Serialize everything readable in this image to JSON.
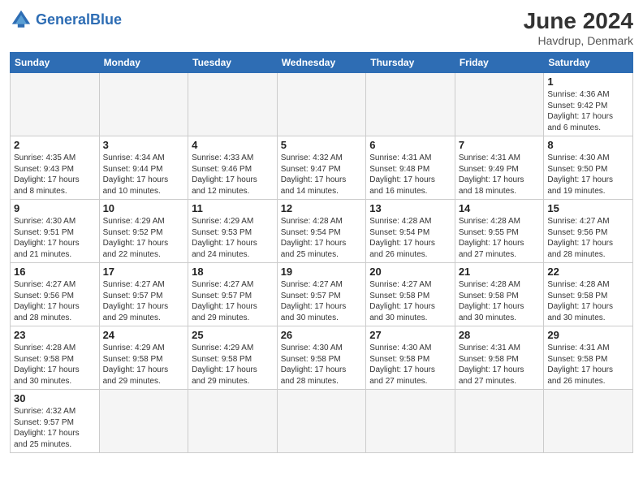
{
  "header": {
    "logo_general": "General",
    "logo_blue": "Blue",
    "month_title": "June 2024",
    "location": "Havdrup, Denmark"
  },
  "days_of_week": [
    "Sunday",
    "Monday",
    "Tuesday",
    "Wednesday",
    "Thursday",
    "Friday",
    "Saturday"
  ],
  "weeks": [
    [
      {
        "day": "",
        "info": ""
      },
      {
        "day": "",
        "info": ""
      },
      {
        "day": "",
        "info": ""
      },
      {
        "day": "",
        "info": ""
      },
      {
        "day": "",
        "info": ""
      },
      {
        "day": "",
        "info": ""
      },
      {
        "day": "1",
        "info": "Sunrise: 4:36 AM\nSunset: 9:42 PM\nDaylight: 17 hours\nand 6 minutes."
      }
    ],
    [
      {
        "day": "2",
        "info": "Sunrise: 4:35 AM\nSunset: 9:43 PM\nDaylight: 17 hours\nand 8 minutes."
      },
      {
        "day": "3",
        "info": "Sunrise: 4:34 AM\nSunset: 9:44 PM\nDaylight: 17 hours\nand 10 minutes."
      },
      {
        "day": "4",
        "info": "Sunrise: 4:33 AM\nSunset: 9:46 PM\nDaylight: 17 hours\nand 12 minutes."
      },
      {
        "day": "5",
        "info": "Sunrise: 4:32 AM\nSunset: 9:47 PM\nDaylight: 17 hours\nand 14 minutes."
      },
      {
        "day": "6",
        "info": "Sunrise: 4:31 AM\nSunset: 9:48 PM\nDaylight: 17 hours\nand 16 minutes."
      },
      {
        "day": "7",
        "info": "Sunrise: 4:31 AM\nSunset: 9:49 PM\nDaylight: 17 hours\nand 18 minutes."
      },
      {
        "day": "8",
        "info": "Sunrise: 4:30 AM\nSunset: 9:50 PM\nDaylight: 17 hours\nand 19 minutes."
      }
    ],
    [
      {
        "day": "9",
        "info": "Sunrise: 4:30 AM\nSunset: 9:51 PM\nDaylight: 17 hours\nand 21 minutes."
      },
      {
        "day": "10",
        "info": "Sunrise: 4:29 AM\nSunset: 9:52 PM\nDaylight: 17 hours\nand 22 minutes."
      },
      {
        "day": "11",
        "info": "Sunrise: 4:29 AM\nSunset: 9:53 PM\nDaylight: 17 hours\nand 24 minutes."
      },
      {
        "day": "12",
        "info": "Sunrise: 4:28 AM\nSunset: 9:54 PM\nDaylight: 17 hours\nand 25 minutes."
      },
      {
        "day": "13",
        "info": "Sunrise: 4:28 AM\nSunset: 9:54 PM\nDaylight: 17 hours\nand 26 minutes."
      },
      {
        "day": "14",
        "info": "Sunrise: 4:28 AM\nSunset: 9:55 PM\nDaylight: 17 hours\nand 27 minutes."
      },
      {
        "day": "15",
        "info": "Sunrise: 4:27 AM\nSunset: 9:56 PM\nDaylight: 17 hours\nand 28 minutes."
      }
    ],
    [
      {
        "day": "16",
        "info": "Sunrise: 4:27 AM\nSunset: 9:56 PM\nDaylight: 17 hours\nand 28 minutes."
      },
      {
        "day": "17",
        "info": "Sunrise: 4:27 AM\nSunset: 9:57 PM\nDaylight: 17 hours\nand 29 minutes."
      },
      {
        "day": "18",
        "info": "Sunrise: 4:27 AM\nSunset: 9:57 PM\nDaylight: 17 hours\nand 29 minutes."
      },
      {
        "day": "19",
        "info": "Sunrise: 4:27 AM\nSunset: 9:57 PM\nDaylight: 17 hours\nand 30 minutes."
      },
      {
        "day": "20",
        "info": "Sunrise: 4:27 AM\nSunset: 9:58 PM\nDaylight: 17 hours\nand 30 minutes."
      },
      {
        "day": "21",
        "info": "Sunrise: 4:28 AM\nSunset: 9:58 PM\nDaylight: 17 hours\nand 30 minutes."
      },
      {
        "day": "22",
        "info": "Sunrise: 4:28 AM\nSunset: 9:58 PM\nDaylight: 17 hours\nand 30 minutes."
      }
    ],
    [
      {
        "day": "23",
        "info": "Sunrise: 4:28 AM\nSunset: 9:58 PM\nDaylight: 17 hours\nand 30 minutes."
      },
      {
        "day": "24",
        "info": "Sunrise: 4:29 AM\nSunset: 9:58 PM\nDaylight: 17 hours\nand 29 minutes."
      },
      {
        "day": "25",
        "info": "Sunrise: 4:29 AM\nSunset: 9:58 PM\nDaylight: 17 hours\nand 29 minutes."
      },
      {
        "day": "26",
        "info": "Sunrise: 4:30 AM\nSunset: 9:58 PM\nDaylight: 17 hours\nand 28 minutes."
      },
      {
        "day": "27",
        "info": "Sunrise: 4:30 AM\nSunset: 9:58 PM\nDaylight: 17 hours\nand 27 minutes."
      },
      {
        "day": "28",
        "info": "Sunrise: 4:31 AM\nSunset: 9:58 PM\nDaylight: 17 hours\nand 27 minutes."
      },
      {
        "day": "29",
        "info": "Sunrise: 4:31 AM\nSunset: 9:58 PM\nDaylight: 17 hours\nand 26 minutes."
      }
    ],
    [
      {
        "day": "30",
        "info": "Sunrise: 4:32 AM\nSunset: 9:57 PM\nDaylight: 17 hours\nand 25 minutes."
      },
      {
        "day": "",
        "info": ""
      },
      {
        "day": "",
        "info": ""
      },
      {
        "day": "",
        "info": ""
      },
      {
        "day": "",
        "info": ""
      },
      {
        "day": "",
        "info": ""
      },
      {
        "day": "",
        "info": ""
      }
    ]
  ]
}
